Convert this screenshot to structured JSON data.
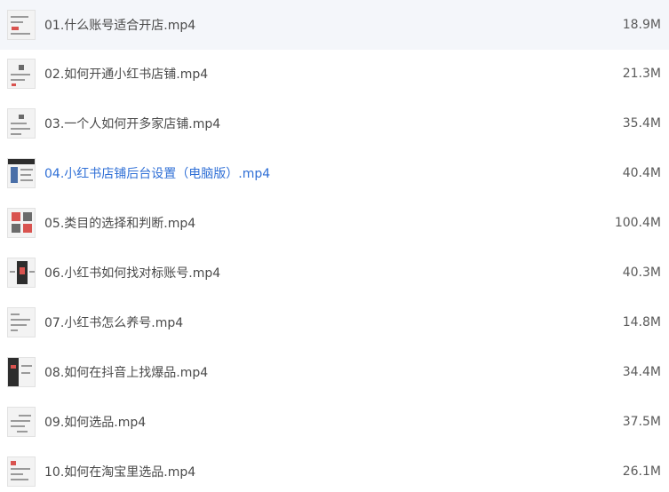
{
  "files": [
    {
      "name": "01.什么账号适合开店.mp4",
      "size": "18.9M",
      "active": false
    },
    {
      "name": "02.如何开通小红书店铺.mp4",
      "size": "21.3M",
      "active": false
    },
    {
      "name": "03.一个人如何开多家店铺.mp4",
      "size": "35.4M",
      "active": false
    },
    {
      "name": "04.小红书店铺后台设置（电脑版）.mp4",
      "size": "40.4M",
      "active": true
    },
    {
      "name": "05.类目的选择和判断.mp4",
      "size": "100.4M",
      "active": false
    },
    {
      "name": "06.小红书如何找对标账号.mp4",
      "size": "40.3M",
      "active": false
    },
    {
      "name": "07.小红书怎么养号.mp4",
      "size": "14.8M",
      "active": false
    },
    {
      "name": "08.如何在抖音上找爆品.mp4",
      "size": "34.4M",
      "active": false
    },
    {
      "name": "09.如何选品.mp4",
      "size": "37.5M",
      "active": false
    },
    {
      "name": "10.如何在淘宝里选品.mp4",
      "size": "26.1M",
      "active": false
    }
  ],
  "colors": {
    "active_text": "#2f6fd6",
    "normal_text": "#4a4a4a"
  },
  "icons": [
    "video-thumbnail-icon"
  ]
}
